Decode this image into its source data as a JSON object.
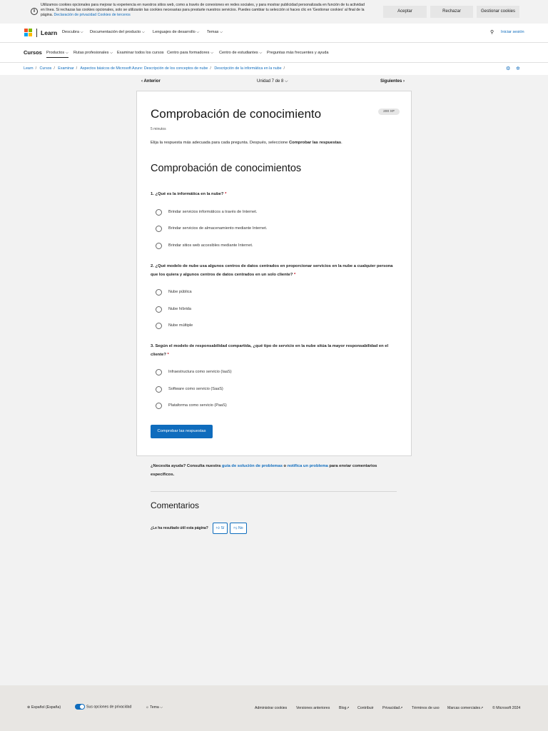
{
  "cookie_banner": {
    "text": "Utilizamos cookies opcionales para mejorar tu experiencia en nuestros sitios web, como a través de conexiones en redes sociales, y para mostrar publicidad personalizada en función de tu actividad en línea. Si rechazas las cookies opcionales, solo se utilizarán las cookies necesarias para prestarte nuestros servicios. Puedes cambiar tu selección si haces clic en 'Gestionar cookies' al final de la página.",
    "privacy_link": "Declaración de privacidad",
    "third_party_link": "Cookies de terceros",
    "accept": "Aceptar",
    "reject": "Rechazar",
    "manage": "Gestionar cookies"
  },
  "topnav": {
    "brand": "Learn",
    "items": [
      "Descubra",
      "Documentación del producto",
      "Lenguajes de desarrollo",
      "Temas"
    ],
    "signin": "Iniciar sesión"
  },
  "subnav": {
    "brand": "Cursos",
    "items": [
      "Productos",
      "Rutas profesionales",
      "Examinar todos los cursos",
      "Centro para formadores",
      "Centro de estudiantes",
      "Preguntas más frecuentes y ayuda"
    ]
  },
  "breadcrumb": [
    "Learn",
    "Cursos",
    "Examinar",
    "Aspectos básicos de Microsoft Azure: Descripción de los conceptos de nube",
    "Descripción de la informática en la nube"
  ],
  "unitnav": {
    "prev": "Anterior",
    "unit": "Unidad 7 de 8",
    "next": "Siguientes"
  },
  "card": {
    "title": "Comprobación de conocimiento",
    "xp": "200 XP",
    "minutes": "5 minutos",
    "instructions_prefix": "Elija la respuesta más adecuada para cada pregunta. Después, seleccione ",
    "instructions_bold": "Comprobar las respuestas",
    "instructions_suffix": ".",
    "section_title": "Comprobación de conocimientos",
    "questions": [
      {
        "text": "1. ¿Qué es la informática en la nube?",
        "options": [
          "Brindar servicios informáticos a través de Internet.",
          "Brindar servicios de almacenamiento mediante Internet.",
          "Brindar sitios web accesibles mediante Internet."
        ]
      },
      {
        "text": "2. ¿Qué modelo de nube usa algunos centros de datos centrados en proporcionar servicios en la nube a cualquier persona que los quiera y algunos centros de datos centrados en un solo cliente?",
        "options": [
          "Nube pública",
          "Nube híbrida",
          "Nube múltiple"
        ]
      },
      {
        "text": "3. Según el modelo de responsabilidad compartida, ¿qué tipo de servicio en la nube sitúa la mayor responsabilidad en el cliente?",
        "options": [
          "Infraestructura como servicio (IaaS)",
          "Software como servicio (SaaS)",
          "Plataforma como servicio (PaaS)"
        ]
      }
    ],
    "required_mark": "*",
    "submit": "Comprobar las respuestas"
  },
  "help": {
    "prefix": "¿Necesita ayuda? Consulta nuestra ",
    "link1": "guía de solución de problemas",
    "middle": " o ",
    "link2": "notifica un problema",
    "suffix": " para enviar comentarios específicos."
  },
  "feedback": {
    "title": "Comentarios",
    "question": "¿Le ha resultado útil esta página?",
    "yes": "Sí",
    "no": "No"
  },
  "footer": {
    "language": "Español (España)",
    "privacy_choices": "Sus opciones de privacidad",
    "theme": "Tema",
    "links": [
      "Administrar cookies",
      "Versiones anteriores",
      "Blog",
      "Contribuir",
      "Privacidad",
      "Términos de uso",
      "Marcas comerciales",
      "© Microsoft 2024"
    ]
  },
  "colors": {
    "accent": "#0f6cbd",
    "required": "#c50f1f",
    "background": "#f2f2f2"
  }
}
